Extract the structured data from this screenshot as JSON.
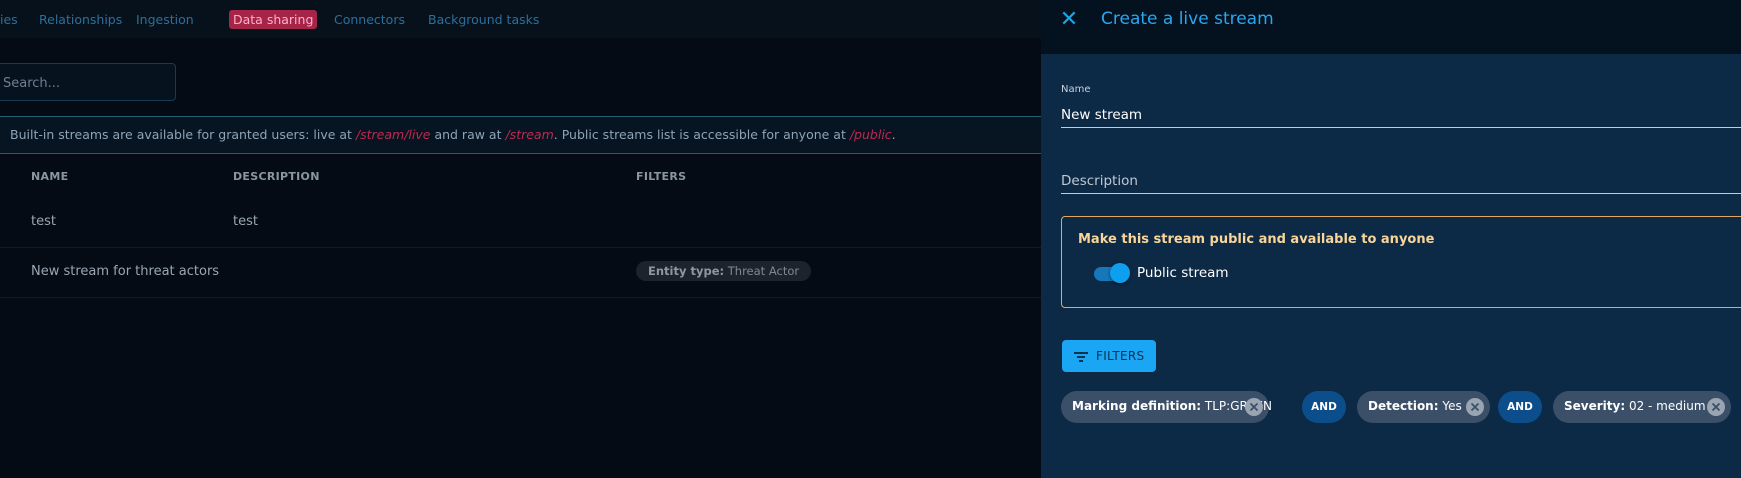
{
  "nav": {
    "items": [
      {
        "label": "ies"
      },
      {
        "label": "Relationships"
      },
      {
        "label": "Ingestion"
      },
      {
        "label": "Data sharing",
        "active": true
      },
      {
        "label": "Connectors"
      },
      {
        "label": "Background tasks"
      }
    ]
  },
  "search": {
    "placeholder": "Search..."
  },
  "info": {
    "text_1": "Built-in streams are available for granted users: live at ",
    "path_live": "/stream/live",
    "text_2": " and raw at ",
    "path_raw": "/stream",
    "text_3": ". Public streams list is accessible for anyone at ",
    "path_public": "/public",
    "text_4": "."
  },
  "table": {
    "headers": {
      "name": "NAME",
      "description": "DESCRIPTION",
      "filters": "FILTERS"
    },
    "rows": [
      {
        "name": "test",
        "description": "test"
      },
      {
        "name": "New stream for threat actors",
        "description": "",
        "filter_key": "Entity type:",
        "filter_value": " Threat Actor"
      }
    ]
  },
  "drawer": {
    "title": "Create a live stream",
    "name_label": "Name",
    "name_value": "New stream",
    "description_placeholder": "Description",
    "public_title": "Make this stream public and available to anyone",
    "public_toggle_label": "Public stream",
    "public_toggle_on": true,
    "filters_button": "FILTERS",
    "chips": [
      {
        "key": "Marking definition:",
        "value": " TLP:GREEN"
      },
      {
        "key": "Detection:",
        "value": " Yes"
      },
      {
        "key": "Severity:",
        "value": " 02 - medium"
      }
    ],
    "and_label": "AND"
  },
  "colors": {
    "accent": "#1ba6f4",
    "active_tab": "#a52447",
    "warning_border": "#e2a860",
    "drawer_bg": "#0c2945"
  }
}
